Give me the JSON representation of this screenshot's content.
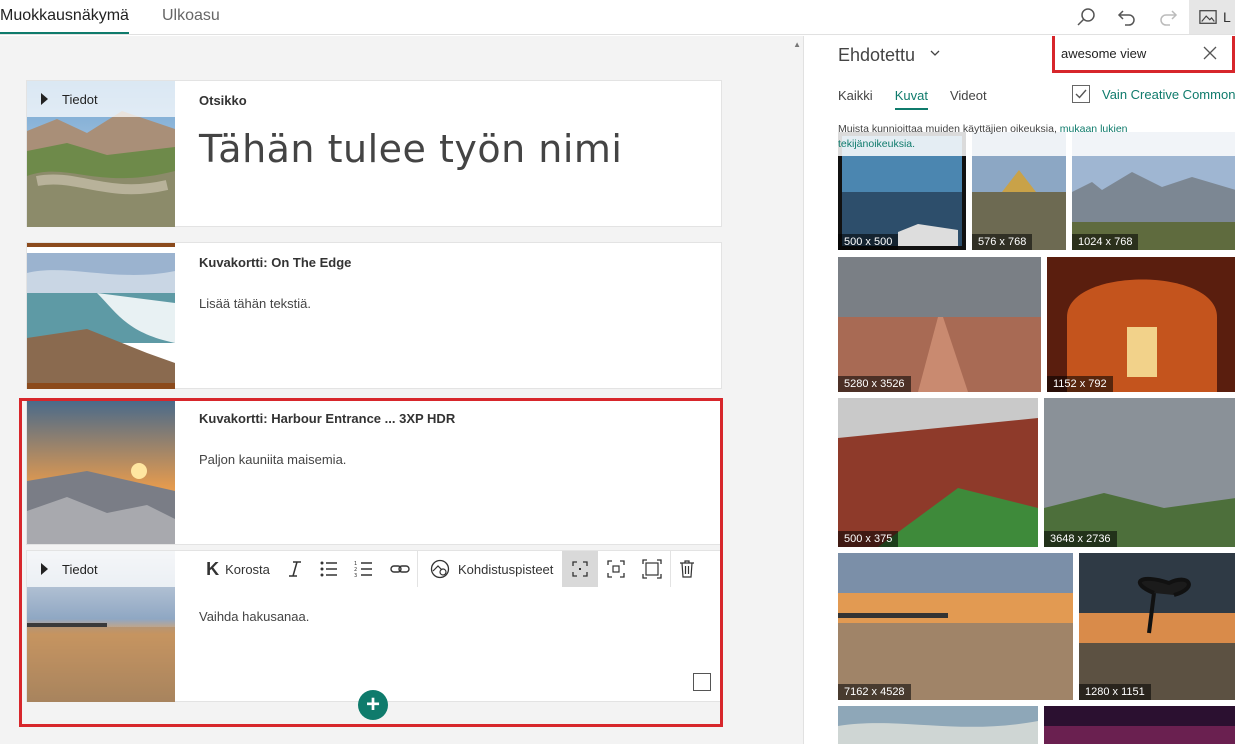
{
  "tabs": [
    {
      "label": "Muokkausnäkymä",
      "active": true
    },
    {
      "label": "Ulkoasu",
      "active": false
    }
  ],
  "toolbar_top": {
    "icons": [
      "search-icon",
      "undo-icon",
      "redo-icon",
      "image-icon"
    ],
    "image_button_label": "L"
  },
  "cards": [
    {
      "tiedot": "Tiedot",
      "title": "Otsikko",
      "big_title": "Tähän tulee työn nimi"
    },
    {
      "title": "Kuvakortti: On The Edge",
      "text": "Lisää tähän tekstiä."
    },
    {
      "title": "Kuvakortti: Harbour Entrance ... 3XP HDR",
      "text": "Paljon kauniita maisemia."
    },
    {
      "tiedot": "Tiedot",
      "text": "Vaihda hakusanaa."
    }
  ],
  "editor_toolbar": {
    "bold_glyph": "K",
    "bold_label": "Korosta",
    "focus_label": "Kohdistuspisteet"
  },
  "add_button": "+",
  "panel": {
    "source": "Ehdotettu",
    "search_value": "awesome view",
    "filters": [
      "Kaikki",
      "Kuvat",
      "Videot"
    ],
    "active_filter": "Kuvat",
    "cc_label": "Vain Creative Commons",
    "notice_text": "Muista kunnioittaa muiden käyttäjien oikeuksia, ",
    "notice_link": "mukaan lukien tekijänoikeuksia."
  },
  "results": [
    {
      "size": "500 x 500"
    },
    {
      "size": "576 x 768"
    },
    {
      "size": "1024 x 768"
    },
    {
      "size": "5280 x 3526"
    },
    {
      "size": "1152 x 792"
    },
    {
      "size": "500 x 375"
    },
    {
      "size": "3648 x 2736"
    },
    {
      "size": "7162 x 4528"
    },
    {
      "size": "1280 x 1151"
    }
  ],
  "colors": {
    "accent": "#0f7b6c",
    "highlight": "#d7262b"
  }
}
